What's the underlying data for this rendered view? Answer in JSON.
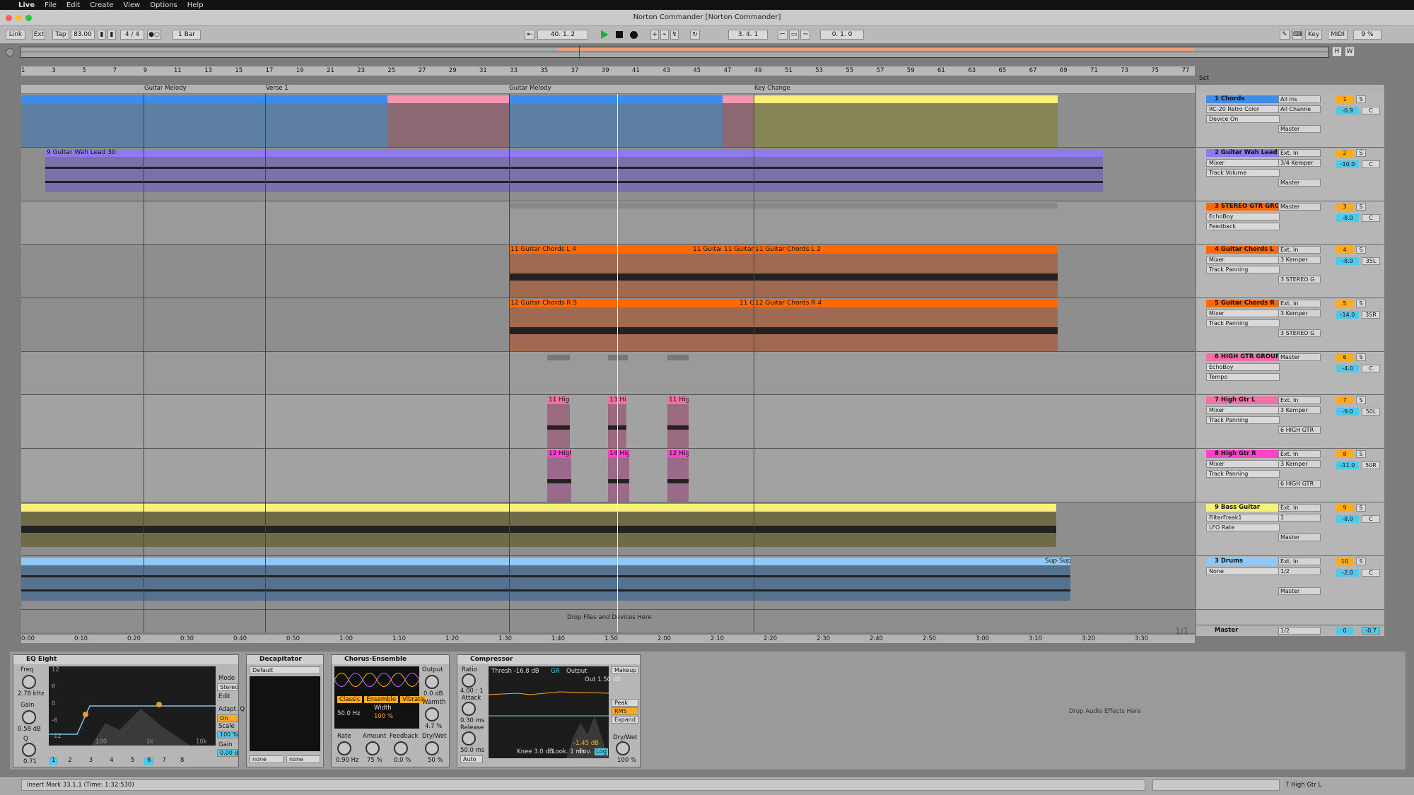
{
  "menubar": {
    "apple": "",
    "items": [
      "Live",
      "File",
      "Edit",
      "Create",
      "View",
      "Options",
      "Help"
    ]
  },
  "window": {
    "title": "Norton Commander  [Norton Commander]"
  },
  "transport": {
    "link": "Link",
    "ext": "Ext",
    "tap": "Tap",
    "tempo": "83.00",
    "meter": "4 / 4",
    "quant": "1 Bar",
    "position": "40.   1.   2",
    "loop_start": "3.   4.   1",
    "loop_length": "0.   1.   0",
    "key": "Key",
    "midi": "MIDI",
    "cpu": "9 %"
  },
  "ruler": {
    "bars": [
      "1",
      "3",
      "5",
      "7",
      "9",
      "11",
      "13",
      "15",
      "17",
      "19",
      "21",
      "23",
      "25",
      "27",
      "29",
      "31",
      "33",
      "35",
      "37",
      "39",
      "41",
      "43",
      "45",
      "47",
      "49",
      "51",
      "53",
      "55",
      "57",
      "59",
      "61",
      "63",
      "65",
      "67",
      "69",
      "71",
      "73",
      "75",
      "77"
    ]
  },
  "locators": [
    "Guitar Melody",
    "Verse 1",
    "Guitar Melody",
    "Key Change"
  ],
  "set_label": "Set",
  "clips": {
    "guitar_wah": "9 Guitar Wah Lead 30",
    "gc_l_1": "11 Guitar Chords L 4",
    "gc_l_2": "11 Guitar",
    "gc_l_3": "11 Guitar",
    "gc_l_4": "11 Guitar Chords L 2",
    "gc_r_1": "12 Guitar Chords R 5",
    "gc_r_2": "11 G",
    "gc_r_3": "12 Guitar Chords R 4",
    "hg_l_1": "11 Hig",
    "hg_l_2": "13 Hi",
    "hg_l_3": "11 Hig",
    "hg_r_1": "12 High",
    "hg_r_2": "14 High",
    "hg_r_3": "12 High",
    "drums_a": "Supe",
    "drums_b": "Sup"
  },
  "drop_files": "Drop Files and Devices Here",
  "tracks": [
    {
      "name": "1 Chords",
      "dev": "RC-20 Retro Color",
      "param": "Device On",
      "in": "All Ins",
      "ch": "All Channe",
      "out": "Master",
      "num": "1",
      "vol": "-0.9",
      "pan": "C",
      "color": "#3d8de8"
    },
    {
      "name": "2 Guitar Wah Lead",
      "dev": "Mixer",
      "param": "Track Volume",
      "in": "Ext. In",
      "ch": "3/4 Kemper",
      "out": "Master",
      "num": "2",
      "vol": "-10.0",
      "pan": "C",
      "color": "#8e7ae8"
    },
    {
      "name": "3 STEREO GTR GROU",
      "dev": "EchoBoy",
      "param": "Feedback",
      "in": "Master",
      "ch": "",
      "out": "",
      "num": "3",
      "vol": "-8.0",
      "pan": "C",
      "color": "#ff6a00"
    },
    {
      "name": "4 Guitar Chords L",
      "dev": "Mixer",
      "param": "Track Panning",
      "in": "Ext. In",
      "ch": "3 Kemper",
      "out": "3 STEREO G",
      "num": "4",
      "vol": "-8.0",
      "pan": "35L",
      "color": "#ff6a00"
    },
    {
      "name": "5 Guitar Chords R",
      "dev": "Mixer",
      "param": "Track Panning",
      "in": "Ext. In",
      "ch": "3 Kemper",
      "out": "3 STEREO G",
      "num": "5",
      "vol": "-14.0",
      "pan": "35R",
      "color": "#ff6a00"
    },
    {
      "name": "6 HIGH GTR GROUP",
      "dev": "EchoBoy",
      "param": "Tempo",
      "in": "Master",
      "ch": "",
      "out": "",
      "num": "6",
      "vol": "-4.0",
      "pan": "C",
      "color": "#f56fa8"
    },
    {
      "name": "7 High Gtr L",
      "dev": "Mixer",
      "param": "Track Panning",
      "in": "Ext. In",
      "ch": "3 Kemper",
      "out": "6 HIGH GTR",
      "num": "7",
      "vol": "-9.0",
      "pan": "50L",
      "color": "#f56fa8"
    },
    {
      "name": "8 High Gtr R",
      "dev": "Mixer",
      "param": "Track Panning",
      "in": "Ext. In",
      "ch": "3 Kemper",
      "out": "6 HIGH GTR",
      "num": "8",
      "vol": "-11.0",
      "pan": "50R",
      "color": "#ff44c8"
    },
    {
      "name": "9 Bass Guitar",
      "dev": "FilterFreak1",
      "param": "LFO Rate",
      "in": "Ext. In",
      "ch": "1",
      "out": "Master",
      "num": "9",
      "vol": "-8.0",
      "pan": "C",
      "color": "#f7f07a"
    },
    {
      "name": "3 Drums",
      "dev": "None",
      "param": "",
      "in": "Ext. In",
      "ch": "1/2",
      "out": "Master",
      "num": "10",
      "vol": "-2.0",
      "pan": "C",
      "color": "#90c8f8"
    }
  ],
  "master": {
    "name": "Master",
    "ch": "1/2",
    "num": "0",
    "vol": "-0.7",
    "page": "1/1"
  },
  "time_ruler": [
    "0:00",
    "0:10",
    "0:20",
    "0:30",
    "0:40",
    "0:50",
    "1:00",
    "1:10",
    "1:20",
    "1:30",
    "1:40",
    "1:50",
    "2:00",
    "2:10",
    "2:20",
    "2:30",
    "2:40",
    "2:50",
    "3:00",
    "3:10",
    "3:20",
    "3:30"
  ],
  "devices": {
    "eq": {
      "title": "EQ Eight",
      "freq_lbl": "Freq",
      "freq": "2.78 kHz",
      "gain_lbl": "Gain",
      "gain": "0.58 dB",
      "q_lbl": "Q",
      "q": "0.71",
      "mode_lbl": "Mode",
      "mode": "Stereo",
      "edit_lbl": "Edit",
      "edit": "A",
      "adapt": "Adapt. Q",
      "on": "On",
      "scale_lbl": "Scale",
      "scale": "100 %",
      "outgain_lbl": "Gain",
      "outgain": "0.00 dB",
      "db": [
        "12",
        "6",
        "0",
        "-6",
        "-12"
      ],
      "hz": [
        "100",
        "1k",
        "10k"
      ],
      "bands": [
        "1",
        "2",
        "3",
        "4",
        "5",
        "6",
        "7",
        "8"
      ]
    },
    "decap": {
      "title": "Decapitator",
      "preset": "Default",
      "sel1": "none",
      "sel2": "none"
    },
    "chorus": {
      "title": "Chorus-Ensemble",
      "output_lbl": "Output",
      "output": "0.0 dB",
      "modes": [
        "Classic",
        "Ensemble",
        "Vibrato"
      ],
      "hz": "50.0 Hz",
      "width_lbl": "Width",
      "width": "100 %",
      "warmth_lbl": "Warmth",
      "warmth": "4.7 %",
      "rate_lbl": "Rate",
      "rate": "0.90 Hz",
      "amount_lbl": "Amount",
      "amount": "75 %",
      "fb_lbl": "Feedback",
      "fb": "0.0 %",
      "dw_lbl": "Dry/Wet",
      "dw": "50 %"
    },
    "comp": {
      "title": "Compressor",
      "ratio_lbl": "Ratio",
      "ratio": "4.00 : 1",
      "attack_lbl": "Attack",
      "attack": "0.30 ms",
      "release_lbl": "Release",
      "release": "50.0 ms",
      "auto": "Auto",
      "thresh": "Thresh -16.8 dB",
      "gr": "GR",
      "output": "Output",
      "out": "Out 1.50 dB",
      "makeup": "Makeup",
      "peak": "Peak",
      "rms": "RMS",
      "expand": "Expand",
      "reduction": "-1.45 dB",
      "dw_lbl": "Dry/Wet",
      "dw": "100 %",
      "knee": "Knee 3.0 dB",
      "look": "Look. 1 ms",
      "env": "Env.",
      "log": "Log"
    },
    "drop_audio": "Drop Audio Effects Here"
  },
  "status": {
    "text": "Insert Mark 33.1.1 (Time: 1:32:530)",
    "right": "7 High Gtr L"
  },
  "colors": {
    "blue": "#3d8de8",
    "violet": "#8e7ae8",
    "orange": "#ff6a00",
    "pink": "#f56fa8",
    "magenta": "#ff44c8",
    "yellow": "#f7f07a",
    "lightblue": "#90c8f8",
    "rose": "#f596b0",
    "orange_accent": "#ffab1f",
    "cyan": "#52c8e8"
  }
}
